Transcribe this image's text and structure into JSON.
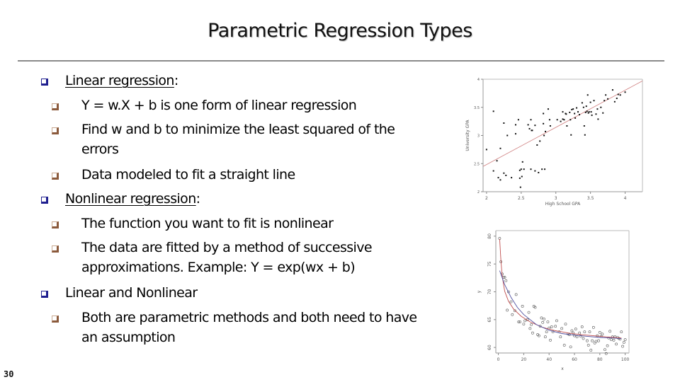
{
  "slide": {
    "title": "Parametric Regression Types",
    "page_number": "30",
    "colors": {
      "bullet_level1": "#1f1f8f",
      "bullet_level2": "#8b5a3c",
      "divider": "#8a8a8a",
      "linear_fit": "#d08080",
      "curve_red": "#c05050",
      "curve_blue": "#5050a0"
    }
  },
  "bullets": [
    {
      "level": 1,
      "icon": "box-bullet-icon",
      "text": "Linear regression",
      "suffix": ":",
      "underline": true
    },
    {
      "level": 2,
      "icon": "box-bullet-icon",
      "text": "Y = w.X + b is one form of linear regression"
    },
    {
      "level": 2,
      "icon": "box-bullet-icon",
      "text": "Find w and b to minimize the least squared of the",
      "continuation": "errors"
    },
    {
      "level": 2,
      "icon": "box-bullet-icon",
      "text": "Data modeled to fit a straight line"
    },
    {
      "level": 1,
      "icon": "box-bullet-icon",
      "text": "Nonlinear regression",
      "suffix": ":",
      "underline": true
    },
    {
      "level": 2,
      "icon": "box-bullet-icon",
      "text": "The function you want to fit is nonlinear"
    },
    {
      "level": 2,
      "icon": "box-bullet-icon",
      "text": "The data are fitted by a method of successive",
      "continuation": "approximations. Example: Y = exp(wx + b)"
    },
    {
      "level": 1,
      "icon": "box-bullet-icon",
      "text": "Linear and Nonlinear"
    },
    {
      "level": 2,
      "icon": "box-bullet-icon",
      "text": "Both are parametric methods and both need to have",
      "continuation": "an assumption"
    }
  ],
  "chart_data": [
    {
      "type": "scatter",
      "title": "",
      "xlabel": "High School GPA",
      "ylabel": "University GPA",
      "xlim": [
        1.95,
        4.25
      ],
      "ylim": [
        2,
        4
      ],
      "xticks": [
        "2",
        "2.5",
        "3",
        "3.5",
        "4"
      ],
      "xtick_values": [
        2,
        2.5,
        3,
        3.5,
        4
      ],
      "yticks": [
        "2",
        "2.5",
        "3",
        "3.5",
        "4"
      ],
      "ytick_values": [
        2,
        2.5,
        3,
        3.5,
        4
      ],
      "grid": false,
      "fit_line": {
        "x": [
          1.95,
          4.25
        ],
        "y": [
          2.45,
          3.97
        ]
      },
      "points": {
        "x": [
          2.0,
          2.1,
          2.1,
          2.15,
          2.17,
          2.2,
          2.2,
          2.25,
          2.25,
          2.28,
          2.3,
          2.36,
          2.42,
          2.42,
          2.46,
          2.48,
          2.48,
          2.49,
          2.5,
          2.51,
          2.52,
          2.54,
          2.6,
          2.62,
          2.64,
          2.64,
          2.65,
          2.66,
          2.7,
          2.7,
          2.73,
          2.75,
          2.77,
          2.8,
          2.82,
          2.82,
          2.83,
          2.84,
          2.85,
          2.89,
          2.91,
          2.92,
          3.02,
          3.07,
          3.1,
          3.1,
          3.12,
          3.14,
          3.15,
          3.16,
          3.2,
          3.21,
          3.22,
          3.23,
          3.25,
          3.27,
          3.28,
          3.3,
          3.32,
          3.34,
          3.38,
          3.4,
          3.41,
          3.42,
          3.43,
          3.44,
          3.45,
          3.46,
          3.47,
          3.48,
          3.5,
          3.51,
          3.52,
          3.55,
          3.58,
          3.6,
          3.61,
          3.65,
          3.68,
          3.7,
          3.72,
          3.75,
          3.82,
          3.85,
          3.88,
          3.9,
          3.93,
          4.0
        ],
        "y": [
          2.75,
          3.43,
          2.37,
          2.55,
          2.25,
          2.77,
          2.21,
          3.22,
          2.33,
          2.29,
          3.0,
          2.25,
          3.19,
          3.03,
          3.28,
          2.38,
          2.24,
          2.08,
          2.4,
          2.27,
          2.53,
          2.4,
          3.19,
          3.12,
          3.28,
          2.4,
          3.09,
          3.09,
          3.18,
          2.37,
          2.83,
          2.34,
          2.9,
          2.4,
          3.39,
          3.21,
          3.0,
          2.4,
          3.07,
          3.47,
          3.28,
          3.17,
          3.28,
          3.25,
          3.29,
          3.42,
          3.28,
          3.39,
          3.38,
          3.17,
          3.41,
          3.28,
          3.01,
          3.46,
          3.47,
          3.39,
          3.31,
          3.49,
          3.42,
          3.37,
          3.58,
          3.5,
          3.17,
          3.01,
          3.41,
          3.52,
          3.43,
          3.72,
          3.4,
          3.42,
          3.59,
          3.42,
          3.36,
          3.62,
          3.38,
          3.47,
          3.29,
          3.5,
          3.4,
          3.62,
          3.72,
          3.65,
          3.81,
          3.6,
          3.66,
          3.73,
          3.72,
          3.77
        ]
      }
    },
    {
      "type": "scatter",
      "title": "",
      "xlabel": "x",
      "ylabel": "y",
      "xlim": [
        -2,
        103
      ],
      "ylim": [
        59,
        81
      ],
      "xticks": [
        "0",
        "20",
        "40",
        "60",
        "80",
        "100"
      ],
      "xtick_values": [
        0,
        20,
        40,
        60,
        80,
        100
      ],
      "yticks": [
        "60",
        "65",
        "70",
        "75",
        "80"
      ],
      "ytick_values": [
        60,
        65,
        70,
        75,
        80
      ],
      "grid": false,
      "curves": [
        {
          "name": "fit-red",
          "color": "#c05050",
          "x": [
            1,
            2,
            3,
            5,
            8,
            12,
            18,
            25,
            35,
            45,
            55,
            65,
            75,
            85,
            97
          ],
          "y": [
            79.5,
            75.6,
            72.8,
            70.1,
            68.3,
            66.9,
            65.6,
            64.6,
            63.6,
            63.0,
            62.6,
            62.3,
            62.1,
            61.9,
            61.7
          ]
        },
        {
          "name": "fit-blue",
          "color": "#5050a0",
          "x": [
            1,
            5,
            10,
            15,
            20,
            30,
            40,
            50,
            60,
            70,
            80,
            90,
            97
          ],
          "y": [
            73.8,
            71.3,
            69.0,
            67.2,
            65.9,
            64.1,
            63.1,
            62.5,
            62.2,
            62.0,
            61.8,
            61.7,
            61.6
          ]
        }
      ],
      "points": {
        "x": [
          1,
          2,
          3,
          4,
          5,
          6,
          7,
          8,
          10,
          11,
          13,
          14,
          16,
          17,
          19,
          20,
          21,
          23,
          24,
          25,
          26,
          27,
          28,
          29,
          31,
          32,
          33,
          34,
          35,
          36,
          37,
          38,
          39,
          40,
          41,
          42,
          43,
          45,
          46,
          48,
          49,
          50,
          52,
          53,
          55,
          56,
          57,
          58,
          59,
          60,
          61,
          62,
          64,
          65,
          66,
          67,
          68,
          70,
          71,
          72,
          73,
          74,
          75,
          76,
          77,
          78,
          79,
          80,
          81,
          82,
          84,
          85,
          86,
          87,
          88,
          89,
          90,
          91,
          92,
          93,
          94,
          95,
          96,
          97,
          98,
          99,
          100
        ],
        "y": [
          79.6,
          75.4,
          73.2,
          72.6,
          72.6,
          72.0,
          66.7,
          70.0,
          68.2,
          65.9,
          66.6,
          69.5,
          64.6,
          64.6,
          67.4,
          64.2,
          64.8,
          65.0,
          66.3,
          63.4,
          64.1,
          62.6,
          67.4,
          67.2,
          62.3,
          62.1,
          63.8,
          65.3,
          64.5,
          65.1,
          61.9,
          62.8,
          64.6,
          63.5,
          61.3,
          63.7,
          62.8,
          63.8,
          64.8,
          62.8,
          61.9,
          63.4,
          60.4,
          64.2,
          62.4,
          62.3,
          60.1,
          63.0,
          62.6,
          62.1,
          63.3,
          61.9,
          62.6,
          62.0,
          63.7,
          61.6,
          62.8,
          61.2,
          60.4,
          62.8,
          59.5,
          61.2,
          63.6,
          60.8,
          61.1,
          62.1,
          61.2,
          62.7,
          62.0,
          62.4,
          59.6,
          58.9,
          60.3,
          61.7,
          62.9,
          61.4,
          61.9,
          61.3,
          61.9,
          60.6,
          61.8,
          61.6,
          61.5,
          62.8,
          60.2,
          60.9,
          61.4
        ]
      }
    }
  ]
}
